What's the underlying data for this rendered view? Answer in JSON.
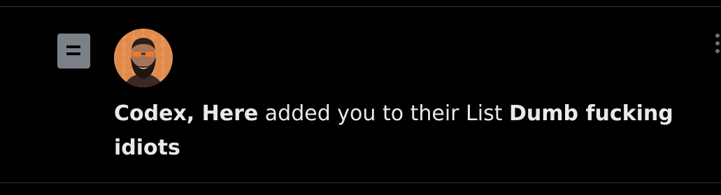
{
  "notification": {
    "type_icon": "list-icon",
    "avatar_alt": "profile photo",
    "actor_name": "Codex, Here",
    "action_text": " added you to their List ",
    "list_name": "Dumb fucking idiots",
    "more_icon": "more-options-icon"
  },
  "colors": {
    "background": "#000000",
    "text": "#e7e9ea",
    "icon_gray": "#7b8087",
    "divider": "#2f3336",
    "avatar_orange": "#e8955a"
  }
}
